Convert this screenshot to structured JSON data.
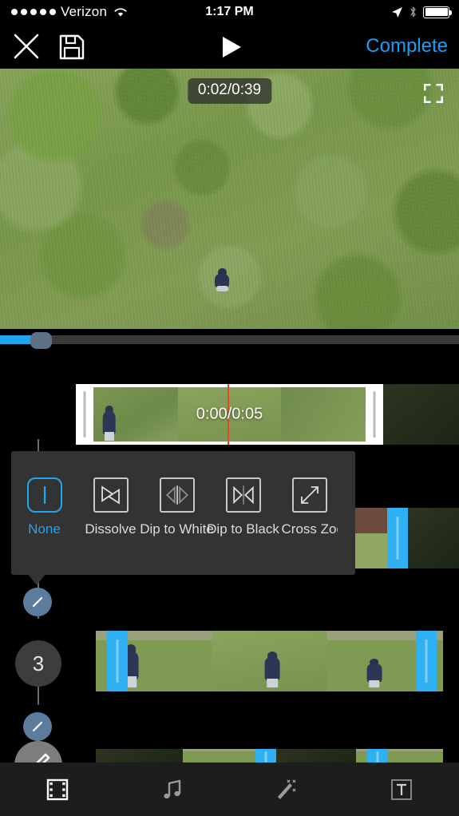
{
  "status_bar": {
    "carrier": "Verizon",
    "signal_dots": 5,
    "time": "1:17 PM",
    "wifi_icon": "wifi-icon",
    "location_icon": "location-arrow-icon",
    "bluetooth_icon": "bluetooth-icon",
    "battery_icon": "battery-full-icon",
    "battery_level": 100
  },
  "toolbar": {
    "close_icon": "close-x-icon",
    "save_icon": "save-floppy-icon",
    "play_icon": "play-triangle-icon",
    "complete_label": "Complete",
    "accent_color": "#1a9ef4"
  },
  "preview": {
    "timecode": "0:02/0:39",
    "current_time": "0:02",
    "total_time": "0:39",
    "expand_icon": "fullscreen-expand-icon"
  },
  "scrubber": {
    "progress_percent": 7,
    "fill_color": "#1fa6f0",
    "track_color": "#3a3a3a",
    "knob_color": "#5e7186"
  },
  "timeline": {
    "edit_icon": "pencil-edit-icon",
    "selected_clip": {
      "timecode": "0:00/0:05",
      "current_time": "0:00",
      "duration": "0:05",
      "playhead_color": "#e8452c"
    },
    "clip_number": "3",
    "transition_node_icon": "transition-slash-icon",
    "trim_handle_color": "#2eb0f2"
  },
  "transition_popup": {
    "options": [
      {
        "label": "None",
        "icon": "transition-none-icon",
        "selected": true
      },
      {
        "label": "Dissolve",
        "icon": "transition-dissolve-icon",
        "selected": false
      },
      {
        "label": "Dip to White",
        "icon": "transition-dip-white-icon",
        "selected": false
      },
      {
        "label": "Dip to Black",
        "icon": "transition-dip-black-icon",
        "selected": false
      },
      {
        "label": "Cross Zoom",
        "icon": "transition-cross-zoom-icon",
        "selected": false
      }
    ],
    "background_color": "#333333",
    "selected_color": "#1fa6f0"
  },
  "tab_bar": {
    "tabs": [
      {
        "label": "Video",
        "icon": "film-strip-icon",
        "active": true
      },
      {
        "label": "Audio",
        "icon": "music-note-icon",
        "active": false
      },
      {
        "label": "Effects",
        "icon": "magic-wand-icon",
        "active": false
      },
      {
        "label": "Text",
        "icon": "text-t-icon",
        "active": false
      }
    ]
  }
}
